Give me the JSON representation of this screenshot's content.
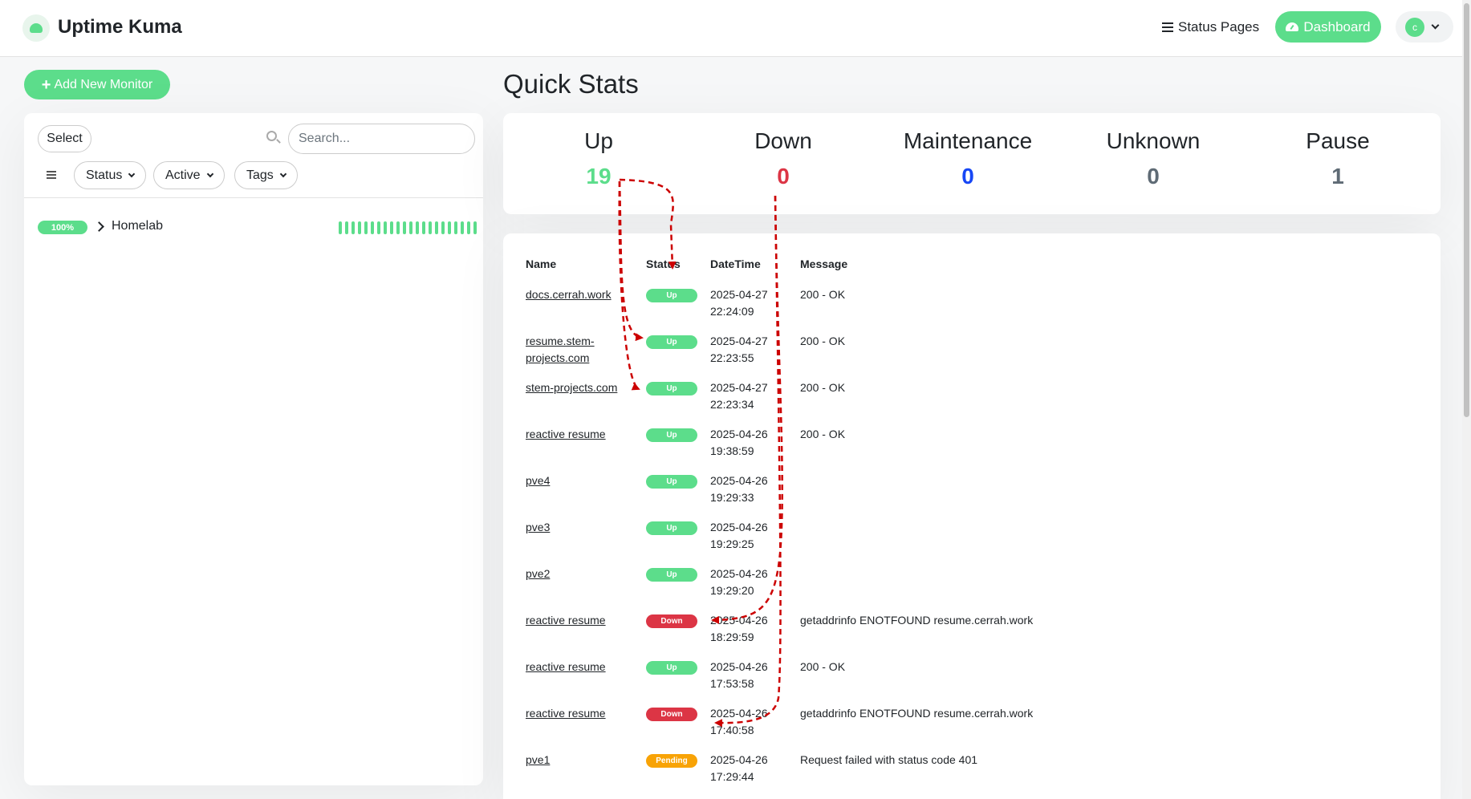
{
  "header": {
    "brand": "Uptime Kuma",
    "status_pages_label": "Status Pages",
    "dashboard_label": "Dashboard",
    "avatar_initial": "c"
  },
  "sidebar": {
    "add_monitor_label": "Add New Monitor",
    "select_label": "Select",
    "search_placeholder": "Search...",
    "filters": [
      "Status",
      "Active",
      "Tags"
    ],
    "group": {
      "uptime_badge": "100%",
      "name": "Homelab",
      "heartbeats": [
        "up",
        "up",
        "up",
        "up",
        "up",
        "up",
        "up",
        "up",
        "up",
        "up",
        "up",
        "up",
        "up",
        "up",
        "up",
        "up",
        "up",
        "up",
        "up",
        "up",
        "up",
        "up"
      ]
    }
  },
  "quick_stats": {
    "title": "Quick Stats",
    "items": [
      {
        "label": "Up",
        "value": "19",
        "color": "#5cdd8b"
      },
      {
        "label": "Down",
        "value": "0",
        "color": "#dc3545"
      },
      {
        "label": "Maintenance",
        "value": "0",
        "color": "#1747f5"
      },
      {
        "label": "Unknown",
        "value": "0",
        "color": "#5f6b75"
      },
      {
        "label": "Pause",
        "value": "1",
        "color": "#5f6b75"
      }
    ]
  },
  "events": {
    "columns": [
      "Name",
      "Status",
      "DateTime",
      "Message"
    ],
    "rows": [
      {
        "name": "docs.cerrah.work",
        "status": "Up",
        "date": "2025-04-27",
        "time": "22:24:09",
        "message": "200 - OK"
      },
      {
        "name": "resume.stem-projects.com",
        "status": "Up",
        "date": "2025-04-27",
        "time": "22:23:55",
        "message": "200 - OK"
      },
      {
        "name": "stem-projects.com",
        "status": "Up",
        "date": "2025-04-27",
        "time": "22:23:34",
        "message": "200 - OK"
      },
      {
        "name": "reactive resume",
        "status": "Up",
        "date": "2025-04-26",
        "time": "19:38:59",
        "message": "200 - OK"
      },
      {
        "name": "pve4",
        "status": "Up",
        "date": "2025-04-26",
        "time": "19:29:33",
        "message": ""
      },
      {
        "name": "pve3",
        "status": "Up",
        "date": "2025-04-26",
        "time": "19:29:25",
        "message": ""
      },
      {
        "name": "pve2",
        "status": "Up",
        "date": "2025-04-26",
        "time": "19:29:20",
        "message": ""
      },
      {
        "name": "reactive resume",
        "status": "Down",
        "date": "2025-04-26",
        "time": "18:29:59",
        "message": "getaddrinfo ENOTFOUND resume.cerrah.work"
      },
      {
        "name": "reactive resume",
        "status": "Up",
        "date": "2025-04-26",
        "time": "17:53:58",
        "message": "200 - OK"
      },
      {
        "name": "reactive resume",
        "status": "Down",
        "date": "2025-04-26",
        "time": "17:40:58",
        "message": "getaddrinfo ENOTFOUND resume.cerrah.work"
      },
      {
        "name": "pve1",
        "status": "Pending",
        "date": "2025-04-26",
        "time": "17:29:44",
        "message": "Request failed with status code 401"
      }
    ]
  },
  "status_colors": {
    "Up": "#5cdd8b",
    "Down": "#dc3545",
    "Pending": "#f8a306"
  },
  "annotation_color": "#cc0000"
}
